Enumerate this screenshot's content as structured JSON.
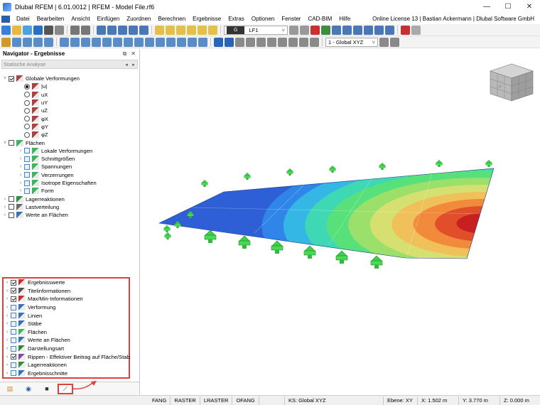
{
  "window": {
    "title": "Dlubal RFEM | 6.01.0012 | RFEM - Model File.rf6",
    "controls": {
      "minimize": "—",
      "maximize": "☐",
      "close": "✕"
    }
  },
  "menu": {
    "items": [
      "Datei",
      "Bearbeiten",
      "Ansicht",
      "Einfügen",
      "Zuordnen",
      "Berechnen",
      "Ergebnisse",
      "Extras",
      "Optionen",
      "Fenster",
      "CAD-BIM",
      "Hilfe"
    ],
    "license": "Online License 13 | Bastian Ackermann | Dlubal Software GmbH"
  },
  "toolbar": {
    "loadcase_tag": "G",
    "loadcase_name": "LF1",
    "view_combo": "1 - Global XYZ"
  },
  "navigator": {
    "title": "Navigator - Ergebnisse",
    "analysis_combo": "Statische Analyse",
    "tree": [
      {
        "label": "Globale Verformungen",
        "type": "check",
        "checked": true,
        "exp": "˅",
        "indent": 0,
        "icon": "deformation-icon"
      },
      {
        "label": "|u|",
        "type": "radio",
        "selected": true,
        "indent": 1,
        "icon": "deformation-icon"
      },
      {
        "label": "uX",
        "type": "radio",
        "selected": false,
        "indent": 1,
        "icon": "deformation-icon"
      },
      {
        "label": "uY",
        "type": "radio",
        "selected": false,
        "indent": 1,
        "icon": "deformation-icon"
      },
      {
        "label": "uZ",
        "type": "radio",
        "selected": false,
        "indent": 1,
        "icon": "deformation-icon"
      },
      {
        "label": "φX",
        "type": "radio",
        "selected": false,
        "indent": 1,
        "icon": "deformation-icon"
      },
      {
        "label": "φY",
        "type": "radio",
        "selected": false,
        "indent": 1,
        "icon": "deformation-icon"
      },
      {
        "label": "φZ",
        "type": "radio",
        "selected": false,
        "indent": 1,
        "icon": "deformation-icon"
      },
      {
        "label": "Flächen",
        "type": "check",
        "checked": false,
        "exp": "˅",
        "indent": 0,
        "icon": "surface-icon"
      },
      {
        "label": "Lokale Verformungen",
        "type": "check",
        "checked": false,
        "blue": true,
        "exp": "›",
        "indent": 1,
        "icon": "surface-icon"
      },
      {
        "label": "Schnittgrößen",
        "type": "check",
        "checked": false,
        "blue": true,
        "exp": "›",
        "indent": 1,
        "icon": "surface-icon"
      },
      {
        "label": "Spannungen",
        "type": "check",
        "checked": false,
        "blue": true,
        "exp": "›",
        "indent": 1,
        "icon": "surface-icon"
      },
      {
        "label": "Verzerrungen",
        "type": "check",
        "checked": false,
        "blue": true,
        "exp": "›",
        "indent": 1,
        "icon": "surface-icon"
      },
      {
        "label": "Isotrope Eigenschaften",
        "type": "check",
        "checked": false,
        "blue": true,
        "exp": "›",
        "indent": 1,
        "icon": "surface-icon"
      },
      {
        "label": "Form",
        "type": "check",
        "checked": false,
        "blue": true,
        "exp": "›",
        "indent": 1,
        "icon": "surface-icon"
      },
      {
        "label": "Lagerreaktionen",
        "type": "check",
        "checked": false,
        "exp": "›",
        "indent": 0,
        "icon": "support-icon"
      },
      {
        "label": "Lastverteilung",
        "type": "check",
        "checked": false,
        "exp": "›",
        "indent": 0,
        "icon": "load-icon"
      },
      {
        "label": "Werte an Flächen",
        "type": "check",
        "checked": false,
        "exp": "›",
        "indent": 0,
        "icon": "values-icon"
      }
    ],
    "display_items": [
      {
        "label": "Ergebnisswerte",
        "checked": true
      },
      {
        "label": "Titelinformationen",
        "checked": true
      },
      {
        "label": "Max/Min-Informationen",
        "checked": true
      },
      {
        "label": "Verformung",
        "checked": false
      },
      {
        "label": "Linien",
        "checked": false
      },
      {
        "label": "Stäbe",
        "checked": false
      },
      {
        "label": "Flächen",
        "checked": false
      },
      {
        "label": "Werte an Flächen",
        "checked": false
      },
      {
        "label": "Darstellungsart",
        "checked": false
      },
      {
        "label": "Rippen - Effektiver Beitrag auf Fläche/Stab",
        "checked": true
      },
      {
        "label": "Lagerreaktionen",
        "checked": false
      },
      {
        "label": "Ergebnisschnitte",
        "checked": false
      }
    ]
  },
  "statusbar": {
    "toggles": [
      "FANG",
      "RASTER",
      "LRASTER",
      "OFANG"
    ],
    "cs": "KS: Global XYZ",
    "plane": "Ebene: XY",
    "x": "X: 1.502 m",
    "y": "Y: 3.770 m",
    "z": "Z: 0.000 m"
  },
  "colors": {
    "accent_red": "#e0403a",
    "contour": [
      "#2e5fd6",
      "#2f86e8",
      "#35b7e6",
      "#3fd8b4",
      "#58e07a",
      "#9be06a",
      "#d6e070",
      "#f0c15a",
      "#f28a3c",
      "#e04f2a",
      "#c82020"
    ]
  }
}
